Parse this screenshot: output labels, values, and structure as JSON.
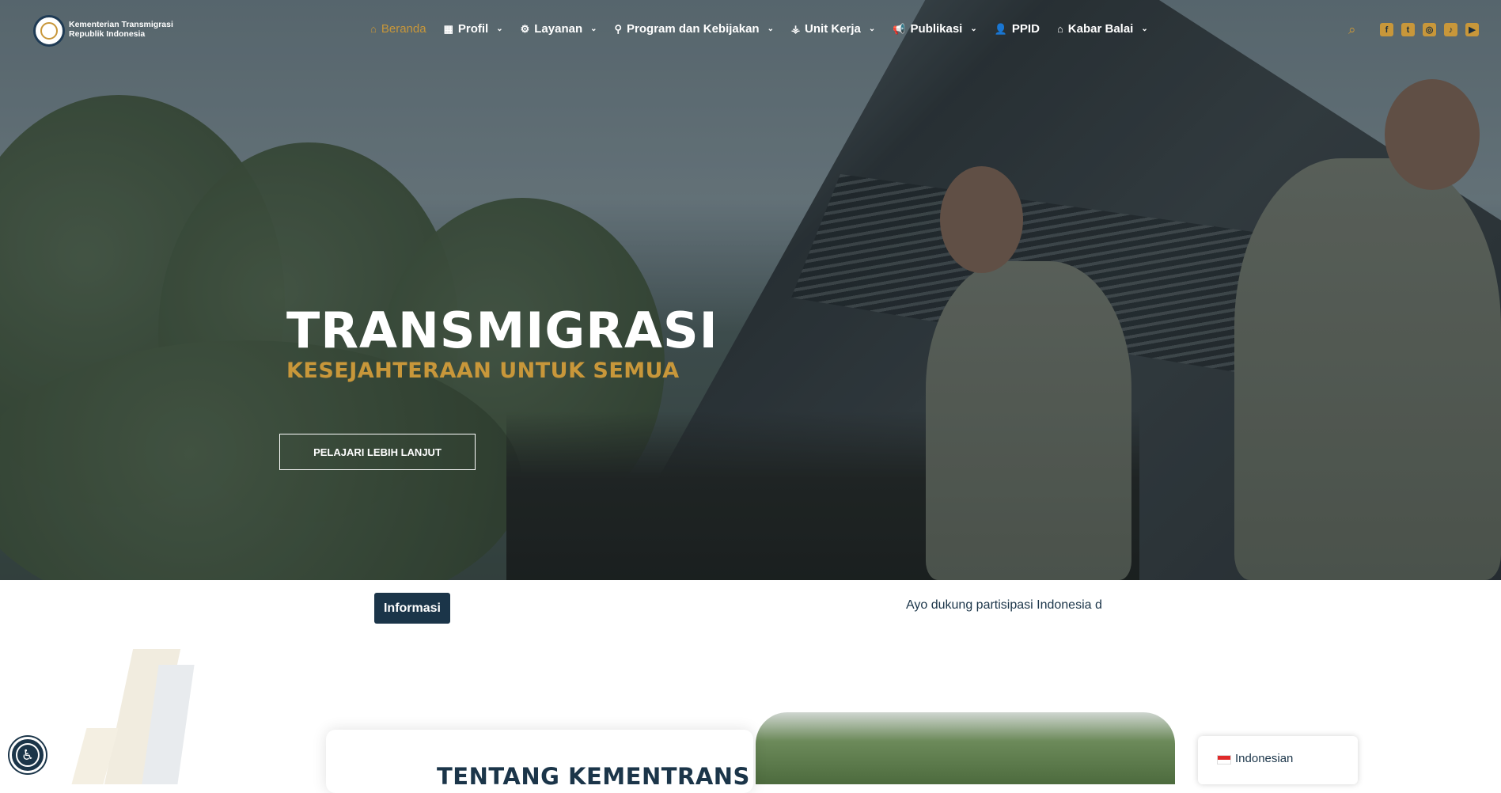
{
  "brand": {
    "line1": "Kementerian Transmigrasi",
    "line2": "Republik Indonesia"
  },
  "nav": {
    "items": [
      {
        "label": "Beranda",
        "icon": "home-icon",
        "glyph": "⌂",
        "dropdown": false,
        "active": true
      },
      {
        "label": "Profil",
        "icon": "building-icon",
        "glyph": "▦",
        "dropdown": true,
        "active": false
      },
      {
        "label": "Layanan",
        "icon": "gear-icon",
        "glyph": "⚙",
        "dropdown": true,
        "active": false
      },
      {
        "label": "Program dan Kebijakan",
        "icon": "network-icon",
        "glyph": "⚲",
        "dropdown": true,
        "active": false
      },
      {
        "label": "Unit Kerja",
        "icon": "sitemap-icon",
        "glyph": "⚶",
        "dropdown": true,
        "active": false
      },
      {
        "label": "Publikasi",
        "icon": "megaphone-icon",
        "glyph": "📢",
        "dropdown": true,
        "active": false
      },
      {
        "label": "PPID",
        "icon": "user-gear-icon",
        "glyph": "👤",
        "dropdown": false,
        "active": false
      },
      {
        "label": "Kabar Balai",
        "icon": "house-user-icon",
        "glyph": "⌂",
        "dropdown": true,
        "active": false
      }
    ],
    "search_icon": "search-icon",
    "socials": [
      {
        "name": "facebook-icon",
        "glyph": "f"
      },
      {
        "name": "twitter-icon",
        "glyph": "t"
      },
      {
        "name": "instagram-icon",
        "glyph": "◎"
      },
      {
        "name": "tiktok-icon",
        "glyph": "♪"
      },
      {
        "name": "youtube-icon",
        "glyph": "▶"
      }
    ]
  },
  "hero": {
    "title": "TRANSMIGRASI",
    "subtitle": "KESEJAHTERAAN UNTUK SEMUA",
    "button_label": "PELAJARI LEBIH LANJUT"
  },
  "info": {
    "badge": "Informasi",
    "ticker": "Ayo dukung partisipasi Indonesia d"
  },
  "about": {
    "title": "TENTANG KEMENTRANS"
  },
  "language": {
    "label": "Indonesian",
    "flag": "indonesia-flag-icon"
  },
  "colors": {
    "accent": "#c8973a",
    "primary": "#1b3549",
    "white": "#ffffff"
  }
}
